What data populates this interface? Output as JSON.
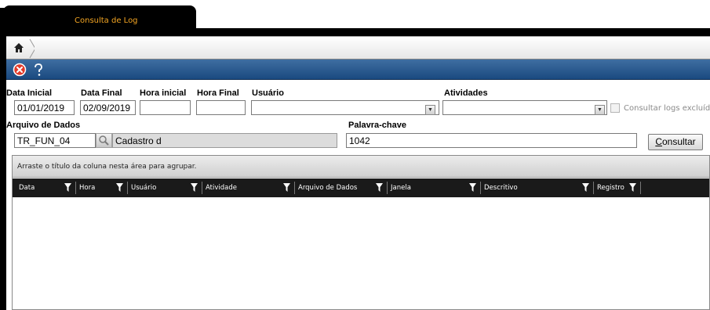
{
  "tab": {
    "label": "Consulta de Log"
  },
  "toolbar": {
    "close_icon": "close-icon",
    "help_icon": "help-icon",
    "accent": "#1a4a80"
  },
  "form": {
    "data_inicial": {
      "label": "Data Inicial",
      "value": "01/01/2019"
    },
    "data_final": {
      "label": "Data Final",
      "value": "02/09/2019"
    },
    "hora_inicial": {
      "label": "Hora inicial",
      "value": ""
    },
    "hora_final": {
      "label": "Hora Final",
      "value": ""
    },
    "usuario": {
      "label": "Usuário",
      "value": ""
    },
    "atividades": {
      "label": "Atividades",
      "value": ""
    },
    "consultar_excluidos": {
      "label": "Consultar logs excluídos",
      "checked": false
    },
    "arquivo_de_dados": {
      "label": "Arquivo de Dados",
      "value": "TR_FUN_04",
      "description": "Cadastro d"
    },
    "palavra_chave": {
      "label": "Palavra-chave",
      "value": "1042"
    },
    "consultar_button": {
      "label_underlined": "C",
      "label_rest": "onsultar"
    }
  },
  "grid": {
    "group_hint": "Arraste o título da coluna nesta área para agrupar.",
    "columns": [
      "Data",
      "Hora",
      "Usuário",
      "Atividade",
      "Arquivo de Dados",
      "Janela",
      "Descritivo",
      "Registro"
    ],
    "rows": []
  }
}
